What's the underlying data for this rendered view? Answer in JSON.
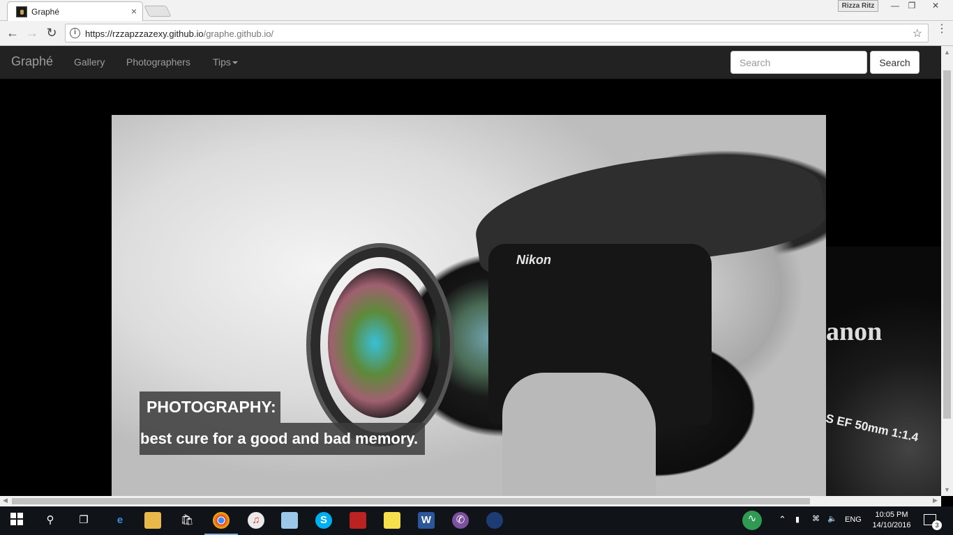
{
  "browser": {
    "tab_title": "Graphé",
    "tab_close": "×",
    "profile_name": "Rizza Ritz",
    "url_host": "https://rzzapzzazexy.github.io",
    "url_path": "/graphe.github.io/",
    "icons": [
      "back-arrow-icon",
      "forward-arrow-icon",
      "reload-icon",
      "info-icon",
      "star-icon",
      "menu-icon"
    ]
  },
  "site": {
    "brand": "Graphé",
    "nav": {
      "gallery": "Gallery",
      "photographers": "Photographers",
      "tips": "Tips"
    },
    "search_placeholder": "Search",
    "search_button": "Search"
  },
  "carousel": {
    "caption_title": "PHOTOGRAPHY:",
    "caption_text": "best cure for a good and bad memory.",
    "camera_brand": "Nikon",
    "next_slide_brand": "anon",
    "next_slide_lens_text": "S  EF  50mm  1:1.4"
  },
  "taskbar": {
    "language": "ENG",
    "time": "10:05 PM",
    "date": "14/10/2016",
    "notification_count": "3",
    "accent": "#7fb0e0"
  }
}
